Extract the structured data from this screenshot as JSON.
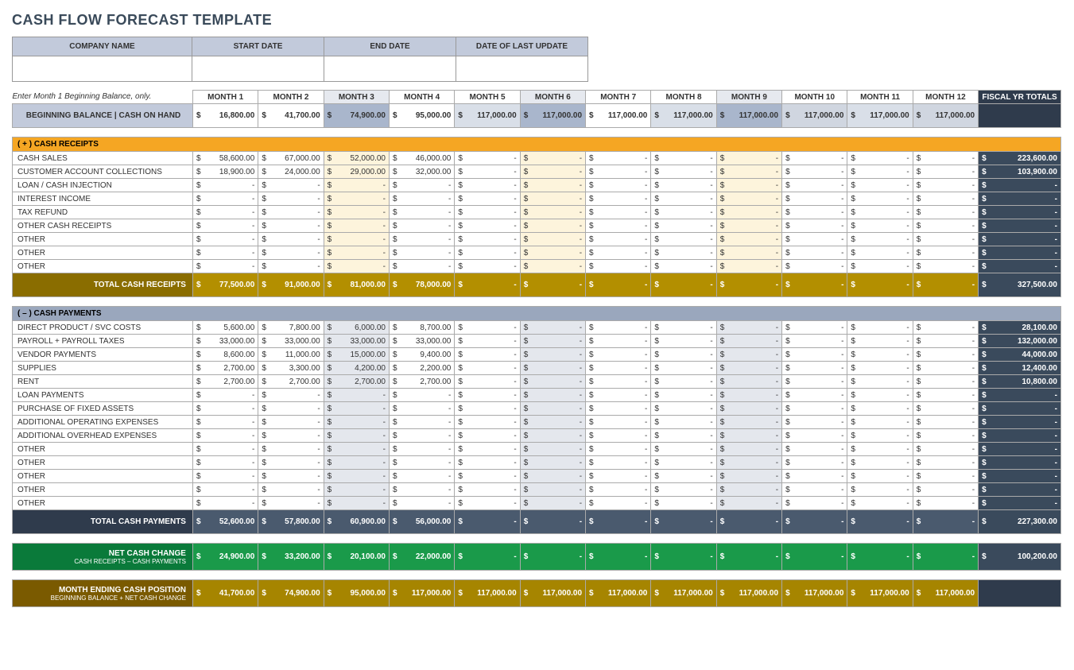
{
  "title": "CASH FLOW FORECAST TEMPLATE",
  "info_headers": [
    "COMPANY NAME",
    "START DATE",
    "END DATE",
    "DATE OF LAST UPDATE"
  ],
  "info_values": [
    "",
    "",
    "",
    ""
  ],
  "note": "Enter Month 1 Beginning Balance, only.",
  "month_headers": [
    "MONTH 1",
    "MONTH 2",
    "MONTH 3",
    "MONTH 4",
    "MONTH 5",
    "MONTH 6",
    "MONTH 7",
    "MONTH 8",
    "MONTH 9",
    "MONTH 10",
    "MONTH 11",
    "MONTH 12"
  ],
  "fiscal_header": "FISCAL YR TOTALS",
  "beginning_label": "BEGINNING BALANCE  |  CASH ON HAND",
  "beginning": [
    "16,800.00",
    "41,700.00",
    "74,900.00",
    "95,000.00",
    "117,000.00",
    "117,000.00",
    "117,000.00",
    "117,000.00",
    "117,000.00",
    "117,000.00",
    "117,000.00",
    "117,000.00"
  ],
  "currency": "$",
  "dash": "-",
  "receipts_header": "( + )   CASH RECEIPTS",
  "receipts_rows": [
    {
      "label": "CASH SALES",
      "vals": [
        "58,600.00",
        "67,000.00",
        "52,000.00",
        "46,000.00",
        "-",
        "-",
        "-",
        "-",
        "-",
        "-",
        "-",
        "-"
      ],
      "total": "223,600.00"
    },
    {
      "label": "CUSTOMER ACCOUNT COLLECTIONS",
      "vals": [
        "18,900.00",
        "24,000.00",
        "29,000.00",
        "32,000.00",
        "-",
        "-",
        "-",
        "-",
        "-",
        "-",
        "-",
        "-"
      ],
      "total": "103,900.00"
    },
    {
      "label": "LOAN / CASH INJECTION",
      "vals": [
        "-",
        "-",
        "-",
        "-",
        "-",
        "-",
        "-",
        "-",
        "-",
        "-",
        "-",
        "-"
      ],
      "total": "-"
    },
    {
      "label": "INTEREST INCOME",
      "vals": [
        "-",
        "-",
        "-",
        "-",
        "-",
        "-",
        "-",
        "-",
        "-",
        "-",
        "-",
        "-"
      ],
      "total": "-"
    },
    {
      "label": "TAX REFUND",
      "vals": [
        "-",
        "-",
        "-",
        "-",
        "-",
        "-",
        "-",
        "-",
        "-",
        "-",
        "-",
        "-"
      ],
      "total": "-"
    },
    {
      "label": "OTHER CASH RECEIPTS",
      "vals": [
        "-",
        "-",
        "-",
        "-",
        "-",
        "-",
        "-",
        "-",
        "-",
        "-",
        "-",
        "-"
      ],
      "total": "-"
    },
    {
      "label": "OTHER",
      "vals": [
        "-",
        "-",
        "-",
        "-",
        "-",
        "-",
        "-",
        "-",
        "-",
        "-",
        "-",
        "-"
      ],
      "total": "-"
    },
    {
      "label": "OTHER",
      "vals": [
        "-",
        "-",
        "-",
        "-",
        "-",
        "-",
        "-",
        "-",
        "-",
        "-",
        "-",
        "-"
      ],
      "total": "-"
    },
    {
      "label": "OTHER",
      "vals": [
        "-",
        "-",
        "-",
        "-",
        "-",
        "-",
        "-",
        "-",
        "-",
        "-",
        "-",
        "-"
      ],
      "total": "-"
    }
  ],
  "receipts_total_label": "TOTAL CASH RECEIPTS",
  "receipts_totals": [
    "77,500.00",
    "91,000.00",
    "81,000.00",
    "78,000.00",
    "-",
    "-",
    "-",
    "-",
    "-",
    "-",
    "-",
    "-"
  ],
  "receipts_grand": "327,500.00",
  "payments_header": "( – )   CASH PAYMENTS",
  "payments_rows": [
    {
      "label": "DIRECT PRODUCT / SVC COSTS",
      "vals": [
        "5,600.00",
        "7,800.00",
        "6,000.00",
        "8,700.00",
        "-",
        "-",
        "-",
        "-",
        "-",
        "-",
        "-",
        "-"
      ],
      "total": "28,100.00"
    },
    {
      "label": "PAYROLL + PAYROLL TAXES",
      "vals": [
        "33,000.00",
        "33,000.00",
        "33,000.00",
        "33,000.00",
        "-",
        "-",
        "-",
        "-",
        "-",
        "-",
        "-",
        "-"
      ],
      "total": "132,000.00"
    },
    {
      "label": "VENDOR PAYMENTS",
      "vals": [
        "8,600.00",
        "11,000.00",
        "15,000.00",
        "9,400.00",
        "-",
        "-",
        "-",
        "-",
        "-",
        "-",
        "-",
        "-"
      ],
      "total": "44,000.00"
    },
    {
      "label": "SUPPLIES",
      "vals": [
        "2,700.00",
        "3,300.00",
        "4,200.00",
        "2,200.00",
        "-",
        "-",
        "-",
        "-",
        "-",
        "-",
        "-",
        "-"
      ],
      "total": "12,400.00"
    },
    {
      "label": "RENT",
      "vals": [
        "2,700.00",
        "2,700.00",
        "2,700.00",
        "2,700.00",
        "-",
        "-",
        "-",
        "-",
        "-",
        "-",
        "-",
        "-"
      ],
      "total": "10,800.00"
    },
    {
      "label": "LOAN PAYMENTS",
      "vals": [
        "-",
        "-",
        "-",
        "-",
        "-",
        "-",
        "-",
        "-",
        "-",
        "-",
        "-",
        "-"
      ],
      "total": "-"
    },
    {
      "label": "PURCHASE OF FIXED ASSETS",
      "vals": [
        "-",
        "-",
        "-",
        "-",
        "-",
        "-",
        "-",
        "-",
        "-",
        "-",
        "-",
        "-"
      ],
      "total": "-"
    },
    {
      "label": "ADDITIONAL OPERATING EXPENSES",
      "vals": [
        "-",
        "-",
        "-",
        "-",
        "-",
        "-",
        "-",
        "-",
        "-",
        "-",
        "-",
        "-"
      ],
      "total": "-"
    },
    {
      "label": "ADDITIONAL OVERHEAD EXPENSES",
      "vals": [
        "-",
        "-",
        "-",
        "-",
        "-",
        "-",
        "-",
        "-",
        "-",
        "-",
        "-",
        "-"
      ],
      "total": "-"
    },
    {
      "label": "OTHER",
      "vals": [
        "-",
        "-",
        "-",
        "-",
        "-",
        "-",
        "-",
        "-",
        "-",
        "-",
        "-",
        "-"
      ],
      "total": "-"
    },
    {
      "label": "OTHER",
      "vals": [
        "-",
        "-",
        "-",
        "-",
        "-",
        "-",
        "-",
        "-",
        "-",
        "-",
        "-",
        "-"
      ],
      "total": "-"
    },
    {
      "label": "OTHER",
      "vals": [
        "-",
        "-",
        "-",
        "-",
        "-",
        "-",
        "-",
        "-",
        "-",
        "-",
        "-",
        "-"
      ],
      "total": "-"
    },
    {
      "label": "OTHER",
      "vals": [
        "-",
        "-",
        "-",
        "-",
        "-",
        "-",
        "-",
        "-",
        "-",
        "-",
        "-",
        "-"
      ],
      "total": "-"
    },
    {
      "label": "OTHER",
      "vals": [
        "-",
        "-",
        "-",
        "-",
        "-",
        "-",
        "-",
        "-",
        "-",
        "-",
        "-",
        "-"
      ],
      "total": "-"
    }
  ],
  "payments_total_label": "TOTAL CASH PAYMENTS",
  "payments_totals": [
    "52,600.00",
    "57,800.00",
    "60,900.00",
    "56,000.00",
    "-",
    "-",
    "-",
    "-",
    "-",
    "-",
    "-",
    "-"
  ],
  "payments_grand": "227,300.00",
  "net_label": "NET CASH CHANGE",
  "net_sub": "CASH RECEIPTS – CASH PAYMENTS",
  "net_vals": [
    "24,900.00",
    "33,200.00",
    "20,100.00",
    "22,000.00",
    "-",
    "-",
    "-",
    "-",
    "-",
    "-",
    "-",
    "-"
  ],
  "net_grand": "100,200.00",
  "end_label": "MONTH ENDING CASH POSITION",
  "end_sub": "BEGINNING BALANCE + NET CASH CHANGE",
  "end_vals": [
    "41,700.00",
    "74,900.00",
    "95,000.00",
    "117,000.00",
    "117,000.00",
    "117,000.00",
    "117,000.00",
    "117,000.00",
    "117,000.00",
    "117,000.00",
    "117,000.00",
    "117,000.00"
  ]
}
